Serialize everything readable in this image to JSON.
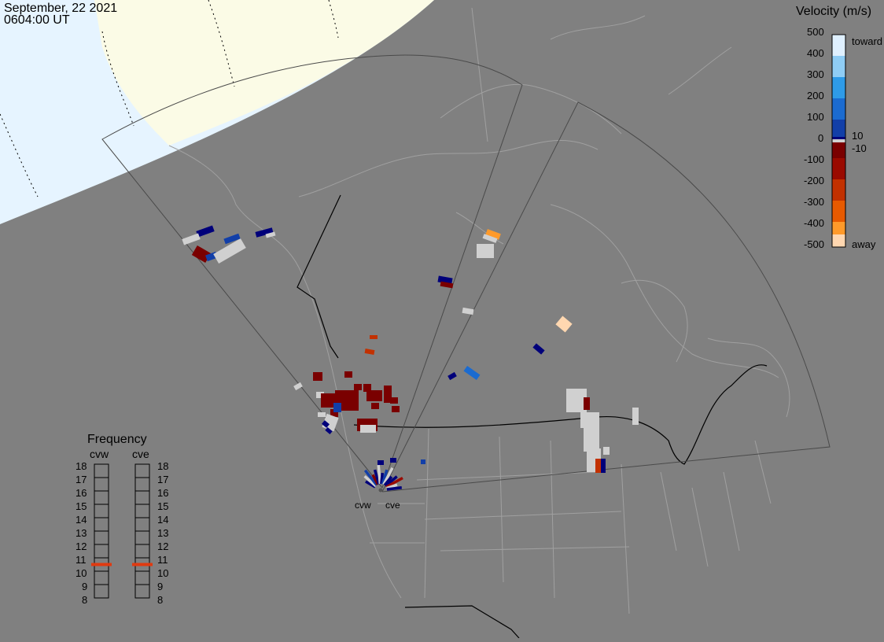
{
  "header": {
    "date": "September, 22 2021",
    "time": "0604:00 UT"
  },
  "velocity_scale": {
    "title": "Velocity (m/s)",
    "ticks": [
      "500",
      "400",
      "300",
      "200",
      "100",
      "0",
      "-100",
      "-200",
      "-300",
      "-400",
      "-500"
    ],
    "toward_label": "toward",
    "away_label": "away",
    "pos_threshold": "10",
    "neg_threshold": "-10",
    "colors": {
      "toward_500": "#dff0ff",
      "toward_400": "#8fcdf5",
      "toward_300": "#2e9be8",
      "toward_200": "#1b6bd0",
      "toward_100": "#123fa8",
      "toward_10": "#00007a",
      "ground_scatter": "#d0d0d0",
      "away_10": "#7a0000",
      "away_100": "#9a0a00",
      "away_200": "#c23100",
      "away_300": "#e85a00",
      "away_400": "#ff9a2a",
      "away_500": "#ffd7b0"
    }
  },
  "frequency": {
    "title": "Frequency",
    "left_radar": "cvw",
    "right_radar": "cve",
    "ticks": [
      "18",
      "17",
      "16",
      "15",
      "14",
      "13",
      "12",
      "11",
      "10",
      "9",
      "8"
    ],
    "cvw_value_mhz": 10.5,
    "cve_value_mhz": 10.5,
    "marker_color": "#e03a10"
  },
  "radars": {
    "west_label": "cvw",
    "east_label": "cve"
  },
  "map": {
    "background_color": "#808080",
    "daylight_color": "#fbfbe6",
    "sky_color": "#e6f4ff",
    "boundary_color": "#a0a0a0"
  }
}
